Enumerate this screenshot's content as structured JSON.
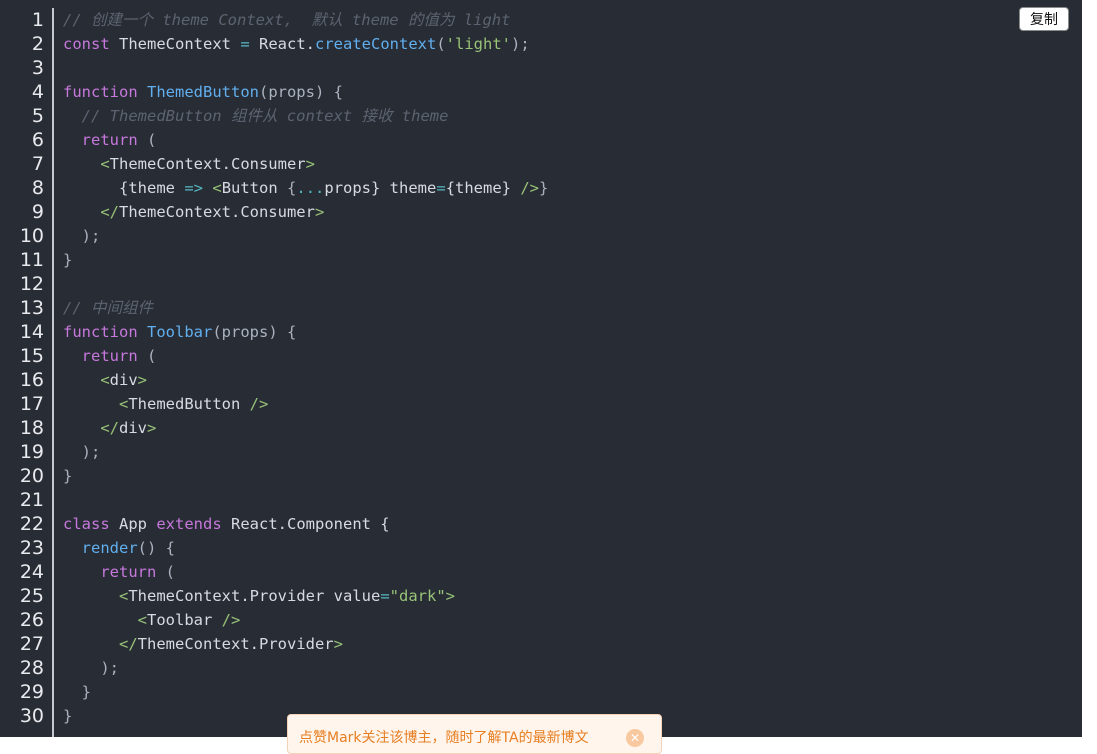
{
  "toolbar": {
    "copy_label": "复制"
  },
  "toast": {
    "text": "点赞Mark关注该博主，随时了解TA的最新博文",
    "close_icon": "close-icon"
  },
  "line_numbers": [
    "1",
    "2",
    "3",
    "4",
    "5",
    "6",
    "7",
    "8",
    "9",
    "10",
    "11",
    "12",
    "13",
    "14",
    "15",
    "16",
    "17",
    "18",
    "19",
    "20",
    "21",
    "22",
    "23",
    "24",
    "25",
    "26",
    "27",
    "28",
    "29",
    "30"
  ],
  "code_lines": [
    [
      {
        "t": "// 创建一个 theme Context,  默认 theme 的值为 light",
        "c": "comment"
      }
    ],
    [
      {
        "t": "const",
        "c": "keyword"
      },
      {
        "t": " ThemeContext ",
        "c": "id"
      },
      {
        "t": "=",
        "c": "op"
      },
      {
        "t": " React.",
        "c": "id"
      },
      {
        "t": "createContext",
        "c": "func"
      },
      {
        "t": "(",
        "c": "plain"
      },
      {
        "t": "'light'",
        "c": "string"
      },
      {
        "t": ");",
        "c": "plain"
      }
    ],
    [],
    [
      {
        "t": "function",
        "c": "keyword"
      },
      {
        "t": " ",
        "c": "plain"
      },
      {
        "t": "ThemedButton",
        "c": "func"
      },
      {
        "t": "(props) {",
        "c": "plain"
      }
    ],
    [
      {
        "t": "  // ThemedButton 组件从 context 接收 theme",
        "c": "comment"
      }
    ],
    [
      {
        "t": "  ",
        "c": "plain"
      },
      {
        "t": "return",
        "c": "keyword"
      },
      {
        "t": " (",
        "c": "plain"
      }
    ],
    [
      {
        "t": "    ",
        "c": "plain"
      },
      {
        "t": "<",
        "c": "tag"
      },
      {
        "t": "ThemeContext.Consumer",
        "c": "id"
      },
      {
        "t": ">",
        "c": "tag"
      }
    ],
    [
      {
        "t": "      {theme ",
        "c": "id"
      },
      {
        "t": "=>",
        "c": "op"
      },
      {
        "t": " ",
        "c": "plain"
      },
      {
        "t": "<",
        "c": "tag"
      },
      {
        "t": "Button ",
        "c": "id"
      },
      {
        "t": "{",
        "c": "plain"
      },
      {
        "t": "...",
        "c": "op"
      },
      {
        "t": "props} theme",
        "c": "id"
      },
      {
        "t": "=",
        "c": "op"
      },
      {
        "t": "{theme} ",
        "c": "id"
      },
      {
        "t": "/>",
        "c": "tag"
      },
      {
        "t": "}",
        "c": "plain"
      }
    ],
    [
      {
        "t": "    ",
        "c": "plain"
      },
      {
        "t": "</",
        "c": "tag"
      },
      {
        "t": "ThemeContext.Consumer",
        "c": "id"
      },
      {
        "t": ">",
        "c": "tag"
      }
    ],
    [
      {
        "t": "  );",
        "c": "plain"
      }
    ],
    [
      {
        "t": "}",
        "c": "plain"
      }
    ],
    [],
    [
      {
        "t": "// 中间组件",
        "c": "comment"
      }
    ],
    [
      {
        "t": "function",
        "c": "keyword"
      },
      {
        "t": " ",
        "c": "plain"
      },
      {
        "t": "Toolbar",
        "c": "func"
      },
      {
        "t": "(props) {",
        "c": "plain"
      }
    ],
    [
      {
        "t": "  ",
        "c": "plain"
      },
      {
        "t": "return",
        "c": "keyword"
      },
      {
        "t": " (",
        "c": "plain"
      }
    ],
    [
      {
        "t": "    ",
        "c": "plain"
      },
      {
        "t": "<",
        "c": "tag"
      },
      {
        "t": "div",
        "c": "id"
      },
      {
        "t": ">",
        "c": "tag"
      }
    ],
    [
      {
        "t": "      ",
        "c": "plain"
      },
      {
        "t": "<",
        "c": "tag"
      },
      {
        "t": "ThemedButton ",
        "c": "id"
      },
      {
        "t": "/>",
        "c": "tag"
      }
    ],
    [
      {
        "t": "    ",
        "c": "plain"
      },
      {
        "t": "</",
        "c": "tag"
      },
      {
        "t": "div",
        "c": "id"
      },
      {
        "t": ">",
        "c": "tag"
      }
    ],
    [
      {
        "t": "  );",
        "c": "plain"
      }
    ],
    [
      {
        "t": "}",
        "c": "plain"
      }
    ],
    [],
    [
      {
        "t": "class",
        "c": "keyword"
      },
      {
        "t": " App ",
        "c": "id"
      },
      {
        "t": "extends",
        "c": "keyword"
      },
      {
        "t": " React.Component {",
        "c": "id"
      }
    ],
    [
      {
        "t": "  ",
        "c": "plain"
      },
      {
        "t": "render",
        "c": "func"
      },
      {
        "t": "() {",
        "c": "plain"
      }
    ],
    [
      {
        "t": "    ",
        "c": "plain"
      },
      {
        "t": "return",
        "c": "keyword"
      },
      {
        "t": " (",
        "c": "plain"
      }
    ],
    [
      {
        "t": "      ",
        "c": "plain"
      },
      {
        "t": "<",
        "c": "tag"
      },
      {
        "t": "ThemeContext.Provider value",
        "c": "id"
      },
      {
        "t": "=",
        "c": "op"
      },
      {
        "t": "\"dark\"",
        "c": "string"
      },
      {
        "t": ">",
        "c": "tag"
      }
    ],
    [
      {
        "t": "        ",
        "c": "plain"
      },
      {
        "t": "<",
        "c": "tag"
      },
      {
        "t": "Toolbar ",
        "c": "id"
      },
      {
        "t": "/>",
        "c": "tag"
      }
    ],
    [
      {
        "t": "      ",
        "c": "plain"
      },
      {
        "t": "</",
        "c": "tag"
      },
      {
        "t": "ThemeContext.Provider",
        "c": "id"
      },
      {
        "t": ">",
        "c": "tag"
      }
    ],
    [
      {
        "t": "    );",
        "c": "plain"
      }
    ],
    [
      {
        "t": "  }",
        "c": "plain"
      }
    ],
    [
      {
        "t": "}",
        "c": "plain"
      }
    ]
  ],
  "colors": {
    "background": "#282c34",
    "comment": "#5c6370",
    "keyword": "#c678dd",
    "function": "#61afef",
    "string": "#98c379",
    "operator": "#56b6c2",
    "toast_text": "#e67e22"
  }
}
